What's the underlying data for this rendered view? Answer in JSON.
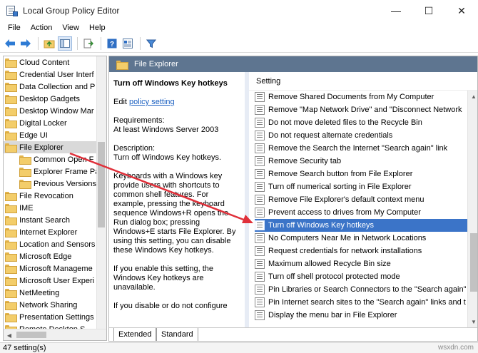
{
  "window": {
    "title": "Local Group Policy Editor",
    "controls": {
      "minimize": "—",
      "maximize": "☐",
      "close": "✕"
    }
  },
  "menu": [
    "File",
    "Action",
    "View",
    "Help"
  ],
  "toolbar": {
    "icons": [
      "back-icon",
      "forward-icon",
      "up-folder-icon",
      "show-hide-tree-icon",
      "export-list-icon",
      "help-icon",
      "properties-icon",
      "filter-icon"
    ]
  },
  "tree": {
    "items": [
      "Cloud Content",
      "Credential User Interf",
      "Data Collection and P",
      "Desktop Gadgets",
      "Desktop Window Mar",
      "Digital Locker",
      "Edge UI",
      "File Explorer",
      "Common Open F",
      "Explorer Frame Pa",
      "Previous Versions",
      "File Revocation",
      "IME",
      "Instant Search",
      "Internet Explorer",
      "Location and Sensors",
      "Microsoft Edge",
      "Microsoft Manageme",
      "Microsoft User Experi",
      "NetMeeting",
      "Network Sharing",
      "Presentation Settings",
      "Remote Desktop S..."
    ],
    "selected": "File Explorer"
  },
  "right_pane": {
    "header": "File Explorer",
    "description": {
      "title": "Turn off Windows Key hotkeys",
      "edit_prefix": "Edit",
      "edit_link": "policy setting",
      "requirements_label": "Requirements:",
      "requirements_value": "At least Windows Server 2003",
      "description_label": "Description:",
      "description_value": "Turn off Windows Key hotkeys.",
      "para1": "Keyboards with a Windows key provide users with shortcuts to common shell features. For example, pressing the keyboard sequence Windows+R opens the Run dialog box; pressing Windows+E starts File Explorer. By using this setting, you can disable these Windows Key hotkeys.",
      "para2": "If you enable this setting, the Windows Key hotkeys are unavailable.",
      "para3": "If you disable or do not configure"
    },
    "list": {
      "column_header": "Setting",
      "selected": "Turn off Windows Key hotkeys",
      "items": [
        "Remove Shared Documents from My Computer",
        "Remove \"Map Network Drive\" and \"Disconnect Network",
        "Do not move deleted files to the Recycle Bin",
        "Do not request alternate credentials",
        "Remove the Search the Internet \"Search again\" link",
        "Remove Security tab",
        "Remove Search button from File Explorer",
        "Turn off numerical sorting in File Explorer",
        "Remove File Explorer's default context menu",
        "Prevent access to drives from My Computer",
        "Turn off Windows Key hotkeys",
        "No Computers Near Me in Network Locations",
        "Request credentials for network installations",
        "Maximum allowed Recycle Bin size",
        "Turn off shell protocol protected mode",
        "Pin Libraries or Search Connectors to the \"Search again\"",
        "Pin Internet search sites to the \"Search again\" links and t",
        "Display the menu bar in File Explorer"
      ]
    },
    "tabs": [
      "Extended",
      "Standard"
    ],
    "active_tab": "Extended"
  },
  "status": {
    "text": "47 setting(s)"
  },
  "watermark": "wsxdn.com",
  "colors": {
    "header_bg": "#5e7590",
    "selection": "#3b74c8",
    "arrow": "#e0303a"
  }
}
